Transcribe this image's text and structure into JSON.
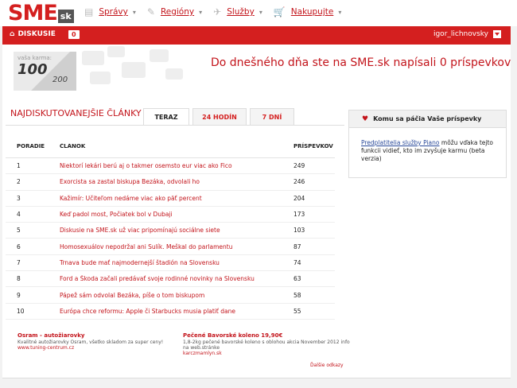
{
  "logo": {
    "brand": "SME",
    "suffix": "sk"
  },
  "nav": [
    {
      "label": "Správy",
      "icon": "newspaper-icon"
    },
    {
      "label": "Regióny",
      "icon": "pencil-icon"
    },
    {
      "label": "Služby",
      "icon": "pin-icon"
    },
    {
      "label": "Nakupujte",
      "icon": "cart-icon"
    }
  ],
  "redbar": {
    "home_label": "DISKUSIE",
    "count": "0",
    "username": "igor_lichnovsky"
  },
  "karma": {
    "label": "vaša karma:",
    "value": "100",
    "max": "200"
  },
  "headline": "Do dnešného dňa ste na SME.sk napísali 0 príspevkov",
  "articles": {
    "title": "NAJDISKUTOVANEJŠIE ČLÁNKY",
    "tabs": [
      "TERAZ",
      "24 HODÍN",
      "7 DNÍ"
    ],
    "headers": {
      "rank": "PORADIE",
      "article": "ČLÁNOK",
      "posts": "PRÍSPEVKOV"
    },
    "rows": [
      {
        "rank": "1",
        "title": "Niektorí lekári berú aj o takmer osemsto eur viac ako Fico",
        "posts": "249"
      },
      {
        "rank": "2",
        "title": "Exorcista sa zastal biskupa Bezáka, odvolali ho",
        "posts": "246"
      },
      {
        "rank": "3",
        "title": "Kažimír: Učiteľom nedáme viac ako päť percent",
        "posts": "204"
      },
      {
        "rank": "4",
        "title": "Keď padol most, Počiatek bol v Dubaji",
        "posts": "173"
      },
      {
        "rank": "5",
        "title": "Diskusie na SME.sk už viac pripomínajú sociálne siete",
        "posts": "103"
      },
      {
        "rank": "6",
        "title": "Homosexuálov nepodržal ani Sulík. Meškal do parlamentu",
        "posts": "87"
      },
      {
        "rank": "7",
        "title": "Trnava bude mať najmodernejší štadión na Slovensku",
        "posts": "74"
      },
      {
        "rank": "8",
        "title": "Ford a Škoda začali predávať svoje rodinné novinky na Slovensku",
        "posts": "63"
      },
      {
        "rank": "9",
        "title": "Pápež sám odvolal Bezáka, píše o tom biskupom",
        "posts": "58"
      },
      {
        "rank": "10",
        "title": "Európa chce reformu: Apple či Starbucks musia platiť dane",
        "posts": "55"
      }
    ]
  },
  "ads": [
    {
      "title": "Osram - autožiarovky",
      "text": "Kvalitné autožiarovky Osram, všetko skladom za super ceny!",
      "url": "www.tuning-centrum.cz"
    },
    {
      "title": "Pečené Bavorské koleno 19,90€",
      "text": "1,8-2kg pečené bavorské koleno s oblohou akcia November 2012 info na web.stránke",
      "url": "karczmamlyn.sk"
    }
  ],
  "ads_more": "Ďalšie odkazy",
  "side": {
    "title": "Komu sa páčia Vaše príspevky",
    "link": "Predplatitelia služby Piano",
    "text": " môžu vďaka tejto funkcii vidieť, kto im zvyšuje karmu (beta verzia)"
  },
  "colors": {
    "brand_red": "#d41f1f",
    "link_red": "#c3141b",
    "link_blue": "#2a4a9a"
  }
}
